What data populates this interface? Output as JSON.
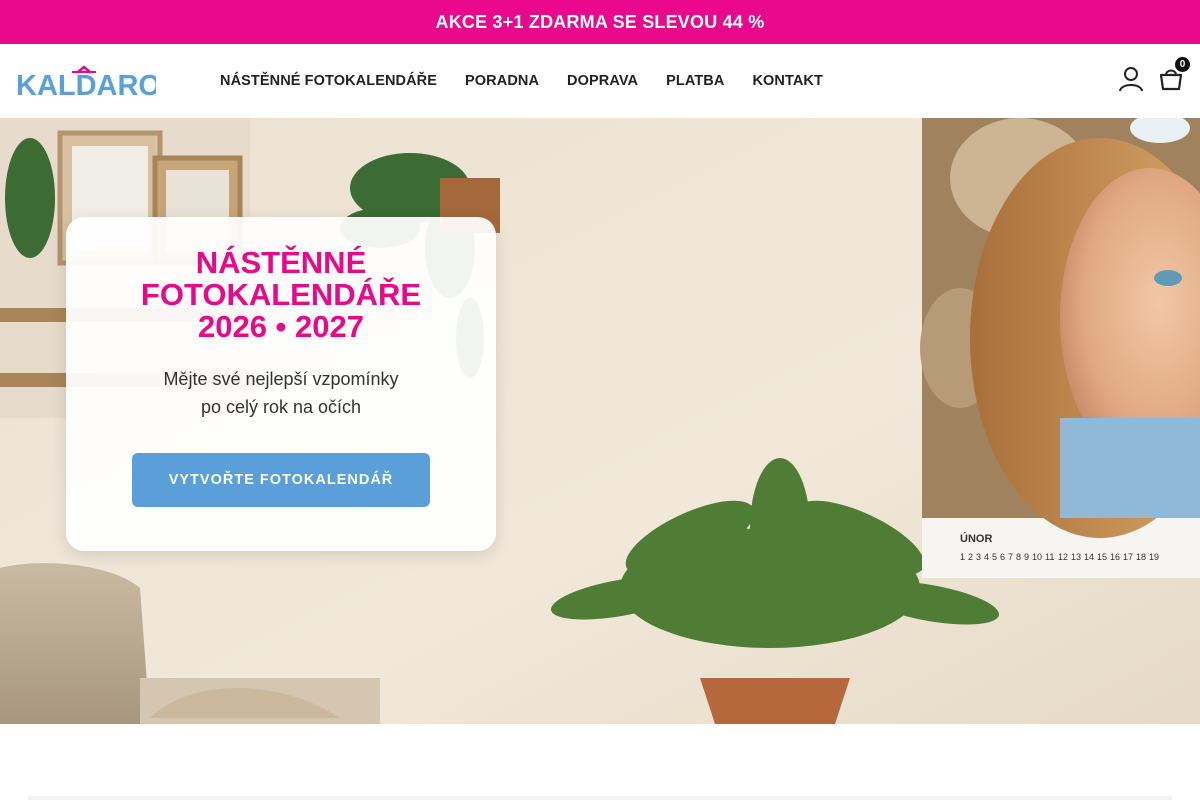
{
  "promo": {
    "text": "AKCE 3+1 ZDARMA SE SLEVOU 44 %"
  },
  "brand": {
    "logo_text": "KALDARO",
    "color_primary": "#5a9fda",
    "color_accent": "#e9078b"
  },
  "nav": {
    "items": [
      {
        "label": "NÁSTĚNNÉ FOTOKALENDÁŘE"
      },
      {
        "label": "PORADNA"
      },
      {
        "label": "DOPRAVA"
      },
      {
        "label": "PLATBA"
      },
      {
        "label": "KONTAKT"
      }
    ]
  },
  "header": {
    "user_icon": "user-icon",
    "cart_icon": "shopping-bag-icon",
    "cart_count": "0"
  },
  "hero": {
    "title_line1": "NÁSTĚNNÉ",
    "title_line2": "FOTOKALENDÁŘE",
    "title_line3": "2026 • 2027",
    "subtitle_line1": "Mějte své nejlepší vzpomínky",
    "subtitle_line2": "po celý rok na očích",
    "cta_label": "VYTVOŘTE FOTOKALENDÁŘ",
    "calendar_month": "ÚNOR",
    "calendar_days": [
      "1",
      "2",
      "3",
      "4",
      "5",
      "6",
      "7",
      "8",
      "9",
      "10",
      "11",
      "12",
      "13",
      "14",
      "15",
      "16",
      "17",
      "18",
      "19"
    ]
  }
}
